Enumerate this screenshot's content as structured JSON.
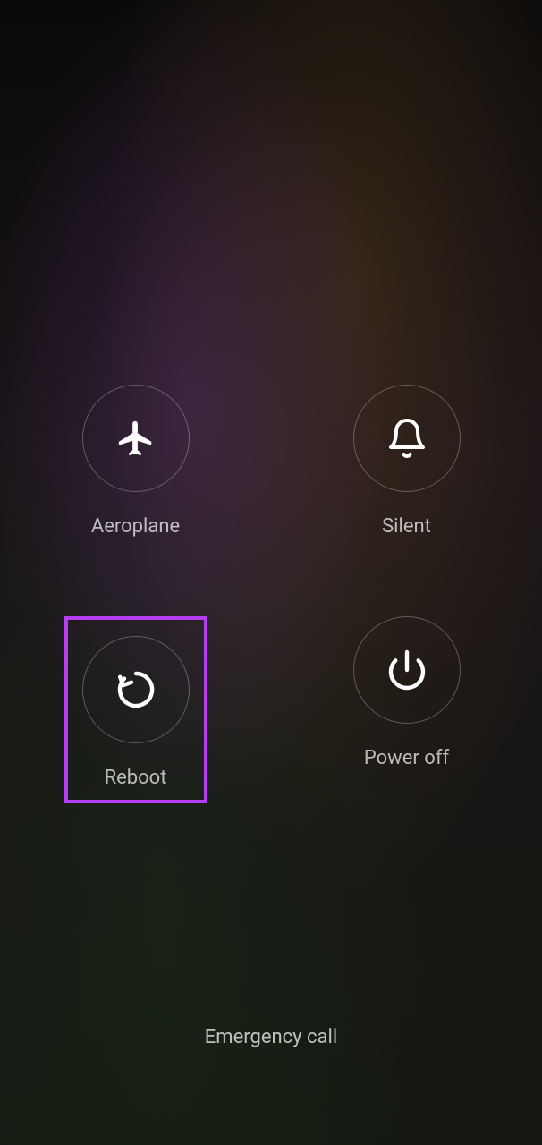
{
  "options": {
    "aeroplane": {
      "label": "Aeroplane",
      "highlighted": false
    },
    "silent": {
      "label": "Silent",
      "highlighted": false
    },
    "reboot": {
      "label": "Reboot",
      "highlighted": true
    },
    "poweroff": {
      "label": "Power off",
      "highlighted": false
    }
  },
  "emergency": {
    "label": "Emergency call"
  },
  "highlight_color": "#b83df2"
}
